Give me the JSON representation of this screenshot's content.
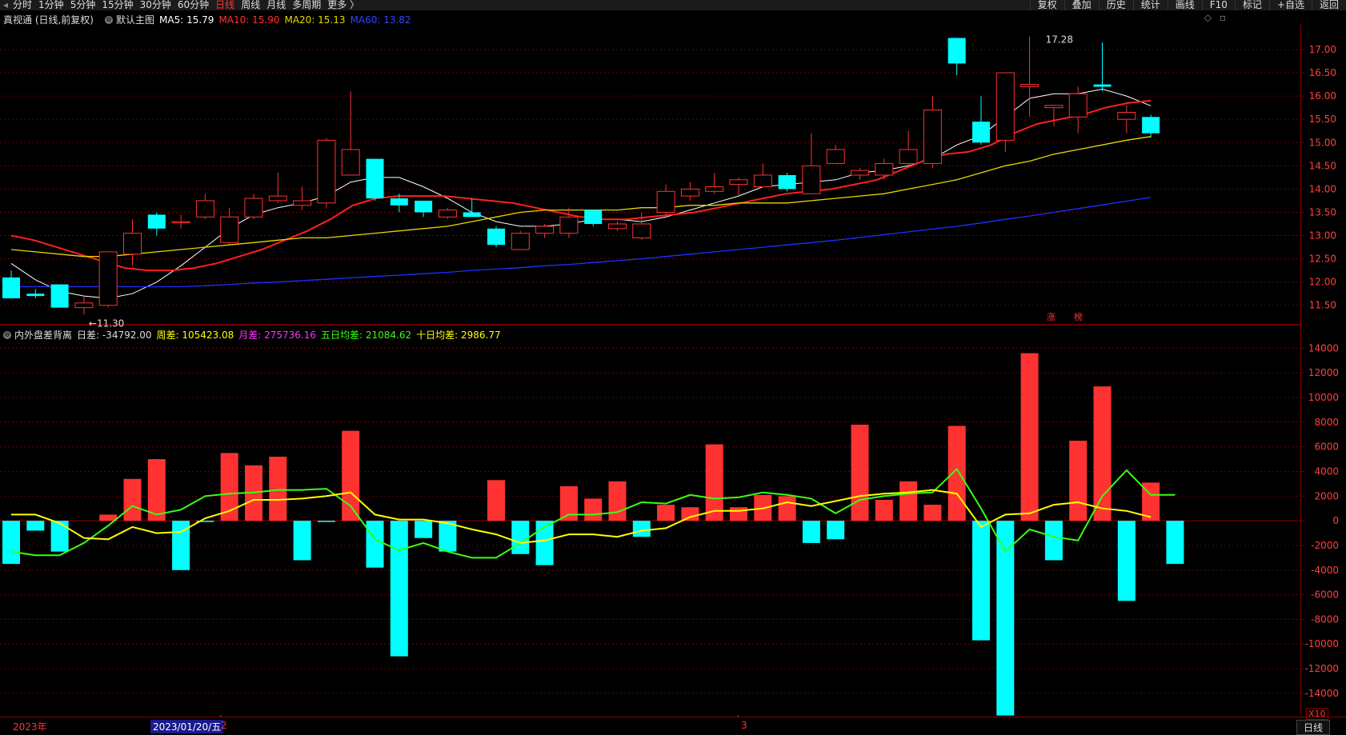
{
  "top_tabs": [
    "分时",
    "1分钟",
    "5分钟",
    "15分钟",
    "30分钟",
    "60分钟",
    "日线",
    "周线",
    "月线",
    "多周期",
    "更多 〉"
  ],
  "active_tab": "日线",
  "toolbar": [
    "复权",
    "叠加",
    "历史",
    "统计",
    "画线",
    "F10",
    "标记",
    "+自选",
    "返回"
  ],
  "main_header": {
    "title": "真视通 (日线,前复权)",
    "indicator_name": "默认主图",
    "ma5": "MA5: 15.79",
    "ma10": "MA10: 15.90",
    "ma20": "MA20: 15.13",
    "ma60": "MA60: 13.82"
  },
  "sub_header": {
    "name": "内外盘差背离",
    "rcha": "日差: -34792.00",
    "zhoucha": "周差: 105423.08",
    "yuecha": "月差: 275736.16",
    "wuri": "五日均差: 21084.62",
    "shiri": "十日均差: 2986.77"
  },
  "annotations": {
    "high": "17.28",
    "low": "11.30",
    "zhang": "涨",
    "bang": "榜"
  },
  "bottom": {
    "year": "2023年",
    "date": "2023/01/20/五",
    "mark_2": "2",
    "mark_3": "3",
    "period": "日线",
    "x10": "X10"
  },
  "colors": {
    "up": "#ff3232",
    "down": "#00ffff",
    "ma5": "#ffffff",
    "ma10": "#ff2020",
    "ma20": "#e6d700",
    "ma60": "#2030ff",
    "diff5": "#39ff14",
    "diff10": "#ffff00"
  },
  "chart_data": [
    {
      "type": "candlestick",
      "title": "真视通 (日线,前复权)",
      "y_ticks": [
        17.0,
        16.5,
        16.0,
        15.5,
        15.0,
        14.5,
        14.0,
        13.5,
        13.0,
        12.5,
        12.0,
        11.5
      ],
      "ylim": [
        11.1,
        17.55
      ],
      "candles": [
        {
          "o": 12.1,
          "h": 12.25,
          "l": 11.7,
          "c": 11.65
        },
        {
          "o": 11.75,
          "h": 11.85,
          "l": 11.65,
          "c": 11.7
        },
        {
          "o": 11.95,
          "h": 11.95,
          "l": 11.45,
          "c": 11.45
        },
        {
          "o": 11.45,
          "h": 11.7,
          "l": 11.3,
          "c": 11.55
        },
        {
          "o": 11.5,
          "h": 12.65,
          "l": 11.45,
          "c": 12.65
        },
        {
          "o": 12.6,
          "h": 13.35,
          "l": 12.35,
          "c": 13.05
        },
        {
          "o": 13.45,
          "h": 13.5,
          "l": 13.0,
          "c": 13.15
        },
        {
          "o": 13.3,
          "h": 13.45,
          "l": 13.15,
          "c": 13.3
        },
        {
          "o": 13.4,
          "h": 13.9,
          "l": 13.35,
          "c": 13.75
        },
        {
          "o": 12.85,
          "h": 13.6,
          "l": 12.8,
          "c": 13.4
        },
        {
          "o": 13.4,
          "h": 13.9,
          "l": 13.35,
          "c": 13.8
        },
        {
          "o": 13.75,
          "h": 14.35,
          "l": 13.7,
          "c": 13.85
        },
        {
          "o": 13.65,
          "h": 14.05,
          "l": 13.55,
          "c": 13.75
        },
        {
          "o": 13.7,
          "h": 15.1,
          "l": 13.6,
          "c": 15.05
        },
        {
          "o": 14.3,
          "h": 16.1,
          "l": 14.3,
          "c": 14.85
        },
        {
          "o": 14.65,
          "h": 14.65,
          "l": 13.75,
          "c": 13.8
        },
        {
          "o": 13.8,
          "h": 13.9,
          "l": 13.5,
          "c": 13.65
        },
        {
          "o": 13.75,
          "h": 13.75,
          "l": 13.4,
          "c": 13.5
        },
        {
          "o": 13.4,
          "h": 13.6,
          "l": 13.35,
          "c": 13.55
        },
        {
          "o": 13.5,
          "h": 13.8,
          "l": 13.45,
          "c": 13.4
        },
        {
          "o": 13.15,
          "h": 13.2,
          "l": 12.75,
          "c": 12.8
        },
        {
          "o": 12.7,
          "h": 13.1,
          "l": 12.7,
          "c": 13.05
        },
        {
          "o": 13.05,
          "h": 13.25,
          "l": 12.95,
          "c": 13.2
        },
        {
          "o": 13.05,
          "h": 13.6,
          "l": 12.95,
          "c": 13.4
        },
        {
          "o": 13.55,
          "h": 13.55,
          "l": 13.2,
          "c": 13.25
        },
        {
          "o": 13.15,
          "h": 13.3,
          "l": 13.1,
          "c": 13.25
        },
        {
          "o": 12.95,
          "h": 13.5,
          "l": 12.9,
          "c": 13.25
        },
        {
          "o": 13.5,
          "h": 14.1,
          "l": 13.45,
          "c": 13.95
        },
        {
          "o": 13.85,
          "h": 14.15,
          "l": 13.75,
          "c": 14.0
        },
        {
          "o": 13.95,
          "h": 14.35,
          "l": 13.9,
          "c": 14.05
        },
        {
          "o": 14.1,
          "h": 14.25,
          "l": 13.85,
          "c": 14.2
        },
        {
          "o": 14.05,
          "h": 14.55,
          "l": 14.05,
          "c": 14.3
        },
        {
          "o": 14.3,
          "h": 14.35,
          "l": 13.95,
          "c": 14.0
        },
        {
          "o": 13.9,
          "h": 15.2,
          "l": 13.9,
          "c": 14.5
        },
        {
          "o": 14.55,
          "h": 14.95,
          "l": 14.55,
          "c": 14.85
        },
        {
          "o": 14.3,
          "h": 14.45,
          "l": 14.2,
          "c": 14.4
        },
        {
          "o": 14.3,
          "h": 14.65,
          "l": 14.2,
          "c": 14.55
        },
        {
          "o": 14.55,
          "h": 15.25,
          "l": 14.5,
          "c": 14.85
        },
        {
          "o": 14.55,
          "h": 16.0,
          "l": 14.45,
          "c": 15.7
        },
        {
          "o": 17.25,
          "h": 17.25,
          "l": 16.45,
          "c": 16.7
        },
        {
          "o": 15.45,
          "h": 16.0,
          "l": 14.95,
          "c": 15.0
        },
        {
          "o": 15.05,
          "h": 16.5,
          "l": 14.8,
          "c": 16.5
        },
        {
          "o": 16.2,
          "h": 17.28,
          "l": 15.55,
          "c": 16.25
        },
        {
          "o": 15.75,
          "h": 15.8,
          "l": 15.35,
          "c": 15.8
        },
        {
          "o": 15.55,
          "h": 16.2,
          "l": 15.2,
          "c": 16.05
        },
        {
          "o": 16.25,
          "h": 17.15,
          "l": 16.1,
          "c": 16.2
        },
        {
          "o": 15.5,
          "h": 15.8,
          "l": 15.2,
          "c": 15.65
        },
        {
          "o": 15.55,
          "h": 15.6,
          "l": 15.1,
          "c": 15.2
        }
      ],
      "series": [
        {
          "name": "MA5",
          "values": [
            12.4,
            12.05,
            11.8,
            11.7,
            11.65,
            11.75,
            12.0,
            12.35,
            12.75,
            13.15,
            13.45,
            13.6,
            13.7,
            13.85,
            14.15,
            14.25,
            14.25,
            14.05,
            13.8,
            13.5,
            13.3,
            13.2,
            13.2,
            13.25,
            13.35,
            13.35,
            13.3,
            13.4,
            13.55,
            13.7,
            13.85,
            14.05,
            14.1,
            14.15,
            14.2,
            14.35,
            14.4,
            14.5,
            14.65,
            14.95,
            15.15,
            15.55,
            15.95,
            16.05,
            16.05,
            16.15,
            16.0,
            15.79
          ]
        },
        {
          "name": "MA10",
          "values": [
            13.0,
            12.9,
            12.75,
            12.6,
            12.45,
            12.3,
            12.25,
            12.25,
            12.3,
            12.4,
            12.55,
            12.7,
            12.9,
            13.1,
            13.35,
            13.65,
            13.8,
            13.85,
            13.85,
            13.85,
            13.8,
            13.75,
            13.7,
            13.6,
            13.5,
            13.4,
            13.35,
            13.35,
            13.4,
            13.45,
            13.5,
            13.6,
            13.7,
            13.8,
            13.9,
            13.95,
            14.0,
            14.1,
            14.2,
            14.4,
            14.6,
            14.75,
            14.8,
            14.95,
            15.2,
            15.4,
            15.5,
            15.6,
            15.75,
            15.85,
            15.9
          ]
        },
        {
          "name": "MA20",
          "values": [
            12.7,
            12.65,
            12.6,
            12.55,
            12.55,
            12.6,
            12.65,
            12.7,
            12.75,
            12.8,
            12.85,
            12.9,
            12.95,
            12.95,
            13.0,
            13.05,
            13.1,
            13.15,
            13.2,
            13.3,
            13.4,
            13.5,
            13.55,
            13.55,
            13.55,
            13.55,
            13.6,
            13.6,
            13.65,
            13.65,
            13.7,
            13.7,
            13.7,
            13.75,
            13.8,
            13.85,
            13.9,
            14.0,
            14.1,
            14.2,
            14.35,
            14.5,
            14.6,
            14.75,
            14.85,
            14.95,
            15.05,
            15.13
          ]
        },
        {
          "name": "MA60",
          "values": [
            11.9,
            11.9,
            11.9,
            11.9,
            11.9,
            11.9,
            11.9,
            11.9,
            11.92,
            11.95,
            11.98,
            12.0,
            12.03,
            12.06,
            12.09,
            12.12,
            12.15,
            12.18,
            12.21,
            12.25,
            12.28,
            12.31,
            12.35,
            12.38,
            12.42,
            12.46,
            12.5,
            12.55,
            12.6,
            12.65,
            12.7,
            12.75,
            12.8,
            12.85,
            12.9,
            12.96,
            13.02,
            13.08,
            13.14,
            13.2,
            13.27,
            13.35,
            13.42,
            13.5,
            13.58,
            13.66,
            13.74,
            13.82
          ]
        }
      ]
    },
    {
      "type": "bar",
      "title": "内外盘差背离",
      "y_ticks": [
        14000,
        12000,
        10000,
        8000,
        6000,
        4000,
        2000,
        0,
        -2000,
        -4000,
        -6000,
        -8000,
        -10000,
        -12000,
        -14000
      ],
      "ylim": [
        -15500,
        15000
      ],
      "values": [
        -3500,
        -800,
        -2500,
        0,
        500,
        3400,
        5000,
        -4000,
        -100,
        5500,
        4500,
        5200,
        -3200,
        -100,
        7300,
        -3800,
        -11000,
        -1400,
        -2500,
        0,
        3300,
        -2700,
        -3600,
        2800,
        1800,
        3200,
        -1300,
        1300,
        1100,
        6200,
        1100,
        2100,
        2000,
        -1800,
        -1500,
        7800,
        1700,
        3200,
        1300,
        7700,
        -9700,
        -15800,
        13600,
        -3200,
        6500,
        10900,
        -6500,
        3100,
        -3500
      ],
      "series": [
        {
          "name": "五日均差",
          "values": [
            -2500,
            -2800,
            -2800,
            -1800,
            -400,
            1200,
            500,
            900,
            2000,
            2200,
            2300,
            2500,
            2500,
            2600,
            1200,
            -1500,
            -2400,
            -1800,
            -2500,
            -3000,
            -3000,
            -1800,
            -500,
            500,
            500,
            700,
            1500,
            1400,
            2100,
            1800,
            1900,
            2300,
            2100,
            1800,
            600,
            1700,
            2000,
            2200,
            2300,
            4200,
            1000,
            -2500,
            -700,
            -1300,
            -1600,
            2000,
            4100,
            2100,
            2100
          ]
        },
        {
          "name": "十日均差",
          "values": [
            500,
            500,
            -200,
            -1400,
            -1500,
            -500,
            -1000,
            -900,
            200,
            800,
            1700,
            1700,
            1800,
            2000,
            2300,
            500,
            100,
            100,
            -200,
            -700,
            -1100,
            -1800,
            -1600,
            -1100,
            -1100,
            -1300,
            -800,
            -600,
            300,
            800,
            800,
            1000,
            1500,
            1200,
            1600,
            2000,
            2200,
            2300,
            2500,
            2200,
            -500,
            500,
            600,
            1300,
            1500,
            1000,
            800,
            300
          ]
        }
      ]
    }
  ]
}
